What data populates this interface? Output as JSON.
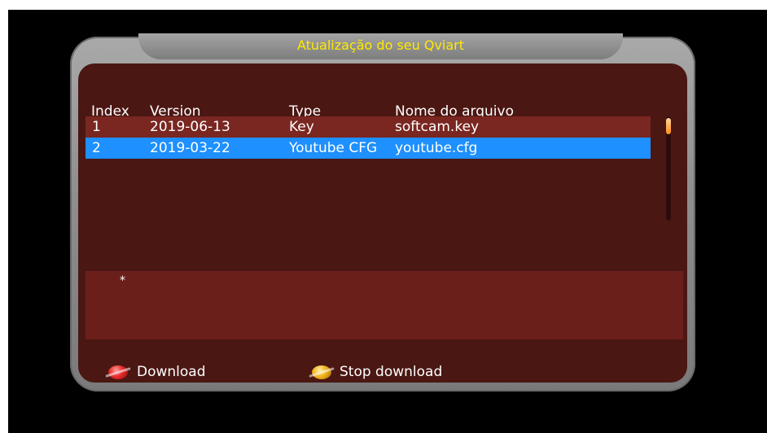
{
  "dialog": {
    "title": "Atualização do seu Qviart"
  },
  "table": {
    "columns": [
      "Index",
      "Version",
      "Type",
      "Nome do arquivo"
    ],
    "rows": [
      {
        "index": "1",
        "version": "2019-06-13",
        "type": "Key",
        "file": "softcam.key"
      },
      {
        "index": "2",
        "version": "2019-03-22",
        "type": "Youtube CFG",
        "file": "youtube.cfg"
      }
    ],
    "selected_row": 2
  },
  "info": {
    "text": "*"
  },
  "footer": {
    "red_label": "Download",
    "yellow_label": "Stop download"
  },
  "colors": {
    "panel_bg": "#4b1713",
    "row_bg": "#7a2621",
    "selected_bg": "#1e90ff",
    "title_color": "#ffea00",
    "info_box": "#6b1f1b"
  },
  "icons": [
    "red-button-icon",
    "yellow-button-icon"
  ]
}
